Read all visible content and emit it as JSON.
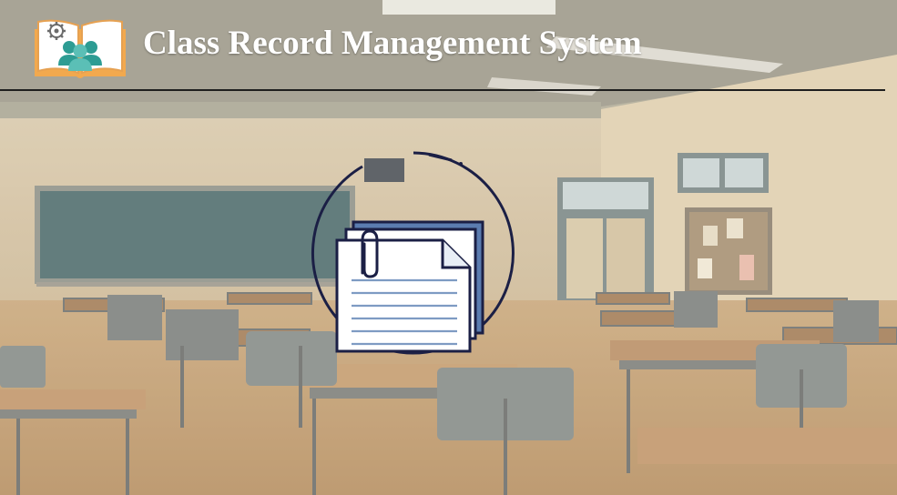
{
  "app": {
    "title": "Class Record Management System"
  },
  "icons": {
    "logo": "open-book-with-people-and-gear-icon",
    "emblem": "documents-with-paperclip-icon"
  },
  "colors": {
    "title_text": "#ffffff",
    "divider": "#1e1e1e",
    "emblem_ring": "#1b1f45",
    "emblem_back_page": "#5b7cb0",
    "logo_people": "#2d9c93",
    "logo_book_border": "#e8a24a"
  }
}
